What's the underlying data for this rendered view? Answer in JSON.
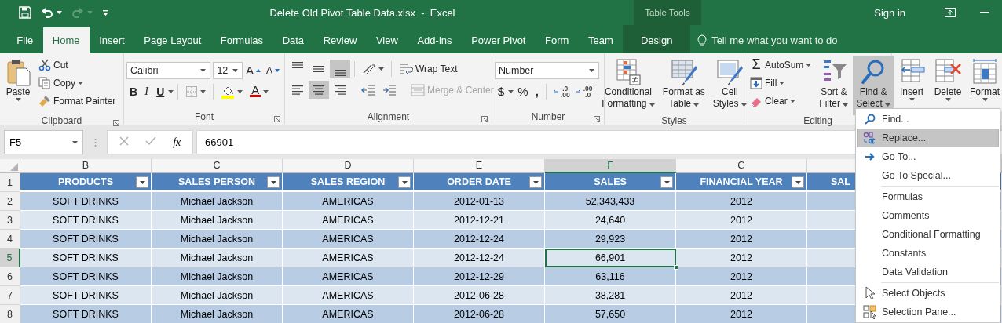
{
  "title_bar": {
    "quick_access": [
      {
        "kind": "save",
        "disabled": false
      },
      {
        "kind": "undo",
        "disabled": false
      },
      {
        "kind": "redo",
        "disabled": true
      },
      {
        "kind": "customize",
        "disabled": false
      }
    ],
    "title": "Delete Old Pivot Table Data.xlsx  -  Excel",
    "context_label": "Table Tools",
    "sign_in": "Sign in"
  },
  "tabs": [
    {
      "label": "File",
      "selected": false,
      "contextual": false
    },
    {
      "label": "Home",
      "selected": true,
      "contextual": false
    },
    {
      "label": "Insert",
      "selected": false,
      "contextual": false
    },
    {
      "label": "Page Layout",
      "selected": false,
      "contextual": false
    },
    {
      "label": "Formulas",
      "selected": false,
      "contextual": false
    },
    {
      "label": "Data",
      "selected": false,
      "contextual": false
    },
    {
      "label": "Review",
      "selected": false,
      "contextual": false
    },
    {
      "label": "View",
      "selected": false,
      "contextual": false
    },
    {
      "label": "Add-ins",
      "selected": false,
      "contextual": false
    },
    {
      "label": "Power Pivot",
      "selected": false,
      "contextual": false
    },
    {
      "label": "Form",
      "selected": false,
      "contextual": false
    },
    {
      "label": "Team",
      "selected": false,
      "contextual": false
    },
    {
      "label": "Design",
      "selected": false,
      "contextual": true
    }
  ],
  "tell_me": "Tell me what you want to do",
  "ribbon": {
    "clipboard": {
      "label": "Clipboard",
      "paste": "Paste",
      "cut": "Cut",
      "copy": "Copy",
      "format_painter": "Format Painter"
    },
    "font": {
      "label": "Font",
      "font_name": "Calibri",
      "font_size": "12",
      "grow": "A",
      "shrink": "A",
      "bold": "B",
      "italic": "I",
      "underline": "U",
      "font_color": "A"
    },
    "alignment": {
      "label": "Alignment",
      "vertical": [
        {
          "kind": "top",
          "selected": false
        },
        {
          "kind": "middle",
          "selected": false
        },
        {
          "kind": "bottom",
          "selected": true
        }
      ],
      "horizontal": [
        {
          "kind": "left",
          "selected": false
        },
        {
          "kind": "center",
          "selected": true
        },
        {
          "kind": "right",
          "selected": false
        }
      ],
      "wrap_text": {
        "label": "Wrap Text",
        "disabled": false
      },
      "merge_center": {
        "label": "Merge & Center",
        "disabled": true
      }
    },
    "number": {
      "label": "Number",
      "format": "Number",
      "currency": "$",
      "percent": "%",
      "comma": ",",
      "decimals": [
        {
          "kind": "increase",
          "top": ".0",
          "bottom": ".00"
        },
        {
          "kind": "decrease",
          "top": ".00",
          "bottom": ".0"
        }
      ]
    },
    "styles": {
      "label": "Styles",
      "buttons": [
        {
          "kind": "conditional",
          "lines": [
            "Conditional",
            "Formatting"
          ]
        },
        {
          "kind": "table",
          "lines": [
            "Format as",
            "Table"
          ]
        },
        {
          "kind": "cell",
          "lines": [
            "Cell",
            "Styles"
          ]
        }
      ]
    },
    "editing": {
      "label": "Editing",
      "small": [
        {
          "kind": "autosum",
          "symbol": "Σ",
          "label": "AutoSum"
        },
        {
          "kind": "fill",
          "label": "Fill"
        },
        {
          "kind": "clear",
          "label": "Clear"
        }
      ],
      "large": [
        {
          "kind": "sort",
          "lines": [
            "Sort &",
            "Filter"
          ],
          "selected": false
        },
        {
          "kind": "find",
          "lines": [
            "Find &",
            "Select"
          ],
          "selected": true
        }
      ]
    },
    "cells": {
      "buttons": [
        {
          "kind": "insert",
          "label": "Insert"
        },
        {
          "kind": "delete",
          "label": "Delete"
        },
        {
          "kind": "format",
          "label": "Format"
        }
      ]
    }
  },
  "formula_bar": {
    "name_box": "F5",
    "function_label": "fx",
    "value": "66901"
  },
  "table": {
    "header_row": "1",
    "columns": [
      {
        "letter": "B",
        "header": "PRODUCTS",
        "selected": false
      },
      {
        "letter": "C",
        "header": "SALES PERSON",
        "selected": false
      },
      {
        "letter": "D",
        "header": "SALES REGION",
        "selected": false
      },
      {
        "letter": "E",
        "header": "ORDER DATE",
        "selected": false
      },
      {
        "letter": "F",
        "header": "SALES",
        "selected": true
      },
      {
        "letter": "G",
        "header": "FINANCIAL YEAR",
        "selected": false
      },
      {
        "header": "SAL",
        "selected": false
      }
    ],
    "rows": [
      {
        "number": "2",
        "selected": false,
        "cells": [
          "SOFT DRINKS",
          "Michael Jackson",
          "AMERICAS",
          "2012-01-13",
          "52,343,433",
          "2012"
        ]
      },
      {
        "number": "3",
        "selected": false,
        "cells": [
          "SOFT DRINKS",
          "Michael Jackson",
          "AMERICAS",
          "2012-12-21",
          "24,640",
          "2012"
        ]
      },
      {
        "number": "4",
        "selected": false,
        "cells": [
          "SOFT DRINKS",
          "Michael Jackson",
          "AMERICAS",
          "2012-12-24",
          "29,923",
          "2012"
        ]
      },
      {
        "number": "5",
        "selected": true,
        "cells": [
          "SOFT DRINKS",
          "Michael Jackson",
          "AMERICAS",
          "2012-12-24",
          "66,901",
          "2012"
        ]
      },
      {
        "number": "6",
        "selected": false,
        "cells": [
          "SOFT DRINKS",
          "Michael Jackson",
          "AMERICAS",
          "2012-12-29",
          "63,116",
          "2012"
        ]
      },
      {
        "number": "7",
        "selected": false,
        "cells": [
          "SOFT DRINKS",
          "Michael Jackson",
          "AMERICAS",
          "2012-06-28",
          "38,281",
          "2012"
        ]
      },
      {
        "number": "8",
        "selected": false,
        "cells": [
          "SOFT DRINKS",
          "Michael Jackson",
          "AMERICAS",
          "2012-06-28",
          "57,650",
          "2012"
        ]
      }
    ]
  },
  "find_menu": {
    "sections": [
      [
        {
          "label": "Find...",
          "kind": "search",
          "selected": false
        },
        {
          "label": "Replace...",
          "kind": "replace",
          "selected": true
        },
        {
          "label": "Go To...",
          "kind": "arrow",
          "selected": false
        },
        {
          "label": "Go To Special...",
          "kind": "plain",
          "selected": false
        }
      ],
      [
        {
          "label": "Formulas",
          "kind": "plain",
          "selected": false
        },
        {
          "label": "Comments",
          "kind": "plain",
          "selected": false
        },
        {
          "label": "Conditional Formatting",
          "kind": "plain",
          "selected": false
        },
        {
          "label": "Constants",
          "kind": "plain",
          "selected": false
        },
        {
          "label": "Data Validation",
          "kind": "plain",
          "selected": false
        }
      ],
      [
        {
          "label": "Select Objects",
          "kind": "pointer",
          "selected": false
        },
        {
          "label": "Selection Pane...",
          "kind": "pane",
          "selected": false
        }
      ]
    ]
  }
}
